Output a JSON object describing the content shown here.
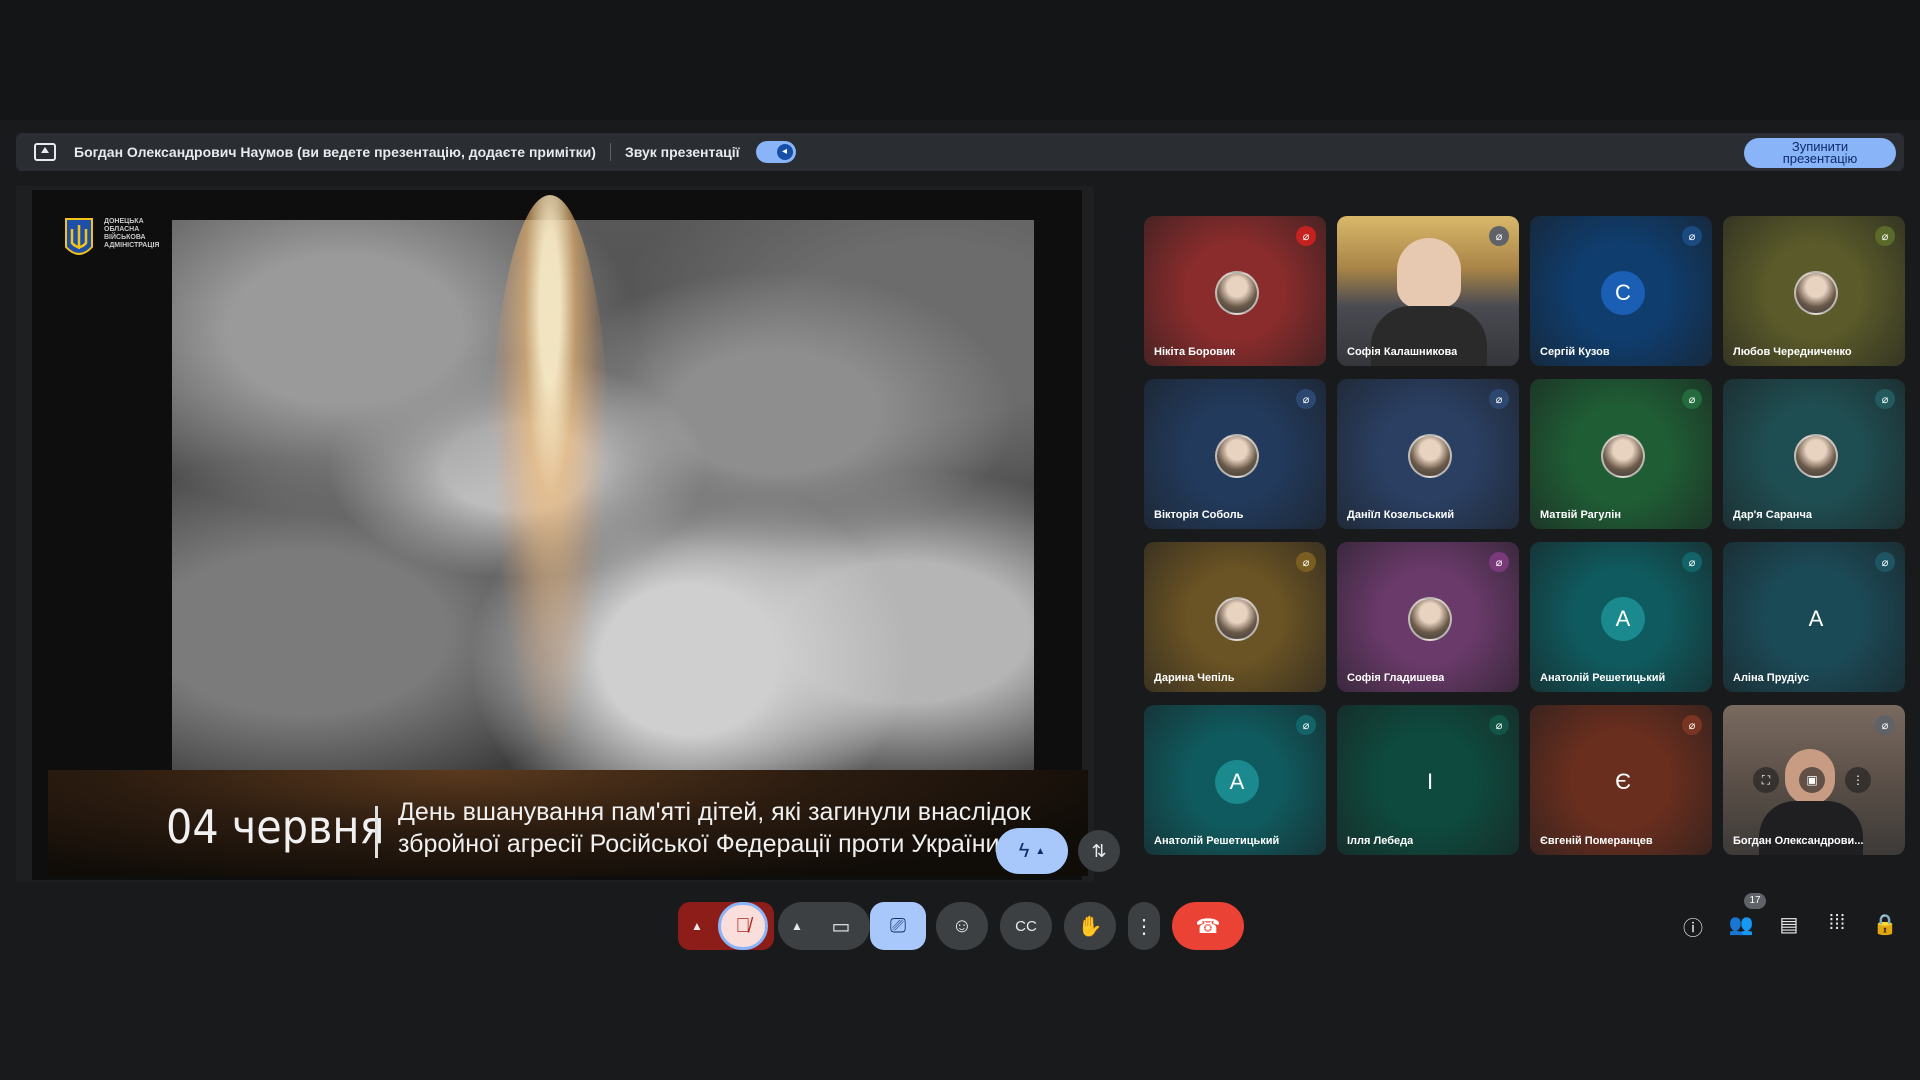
{
  "presenting_bar": {
    "text": "Богдан Олександрович Наумов (ви ведете презентацію, додаєте примітки)",
    "audio_label": "Звук презентації",
    "stop_button": "Зупинити презентацію"
  },
  "slide": {
    "org_text": "ДОНЕЦЬКА ОБЛАСНА ВІЙСЬКОВА АДМІНІСТРАЦІЯ",
    "date": "04 червня",
    "line1": "День вшанування пам'яті дітей, які загинули внаслідок",
    "line2": "збройної агресії Російської Федерації проти України"
  },
  "participants": [
    {
      "name": "Нікіта Боровик",
      "type": "photo",
      "bg": "#8b2c2c",
      "mic_color": "#c5221f",
      "initial": ""
    },
    {
      "name": "Софія Калашникова",
      "type": "camera",
      "bg": "#a88447",
      "mic_color": "#5f6368",
      "initial": ""
    },
    {
      "name": "Сергій Кузов",
      "type": "letter",
      "bg": "#0f3d6e",
      "mic_color": "#1a4a80",
      "avatar_bg": "#1a5fb4",
      "initial": "С"
    },
    {
      "name": "Любов Чередниченко",
      "type": "photo",
      "bg": "#5a5a2a",
      "mic_color": "#5a6a2a",
      "initial": ""
    },
    {
      "name": "Вікторія Соболь",
      "type": "photo",
      "bg": "#223a5c",
      "mic_color": "#2d4870",
      "initial": ""
    },
    {
      "name": "Даніїл Козельський",
      "type": "photo",
      "bg": "#2a3f62",
      "mic_color": "#2d4870",
      "initial": ""
    },
    {
      "name": "Матвій Рагулін",
      "type": "photo",
      "bg": "#1f5e35",
      "mic_color": "#236b3c",
      "initial": ""
    },
    {
      "name": "Дар'я Саранча",
      "type": "photo",
      "bg": "#1f4e52",
      "mic_color": "#235a5e",
      "initial": ""
    },
    {
      "name": "Дарина Чепіль",
      "type": "photo",
      "bg": "#6a5324",
      "mic_color": "#7a5d20",
      "initial": ""
    },
    {
      "name": "Софія Гладишева",
      "type": "photo",
      "bg": "#6a3a6a",
      "mic_color": "#7a3a7a",
      "initial": ""
    },
    {
      "name": "Анатолій Решетицький",
      "type": "letter",
      "bg": "#0f5a5e",
      "mic_color": "#136468",
      "avatar_bg": "#1a8a8f",
      "initial": "А"
    },
    {
      "name": "Аліна Прудіус",
      "type": "letter",
      "bg": "#1b4a57",
      "mic_color": "#1f5563",
      "avatar_bg": "#1b4a57",
      "initial": "А"
    },
    {
      "name": "Анатолій Решетицький",
      "type": "letter",
      "bg": "#0f5a5e",
      "mic_color": "#136468",
      "avatar_bg": "#1a8a8f",
      "initial": "А"
    },
    {
      "name": "Ілля Лебеда",
      "type": "letter",
      "bg": "#0e4a3e",
      "mic_color": "#125446",
      "avatar_bg": "#0e4a3e",
      "initial": "І"
    },
    {
      "name": "Євгеній Померанцев",
      "type": "letter",
      "bg": "#6a2e1e",
      "mic_color": "#7a3422",
      "avatar_bg": "#6a2e1e",
      "initial": "Є"
    },
    {
      "name": "Богдан Олександрови...",
      "type": "camera2",
      "bg": "#5b5048",
      "mic_color": "#5f6368",
      "initial": ""
    }
  ],
  "controls": {
    "participant_count": "17"
  },
  "colors": {
    "accent": "#8ab4f8",
    "end_call": "#ea4335",
    "mic_off": "#f9dedc"
  }
}
